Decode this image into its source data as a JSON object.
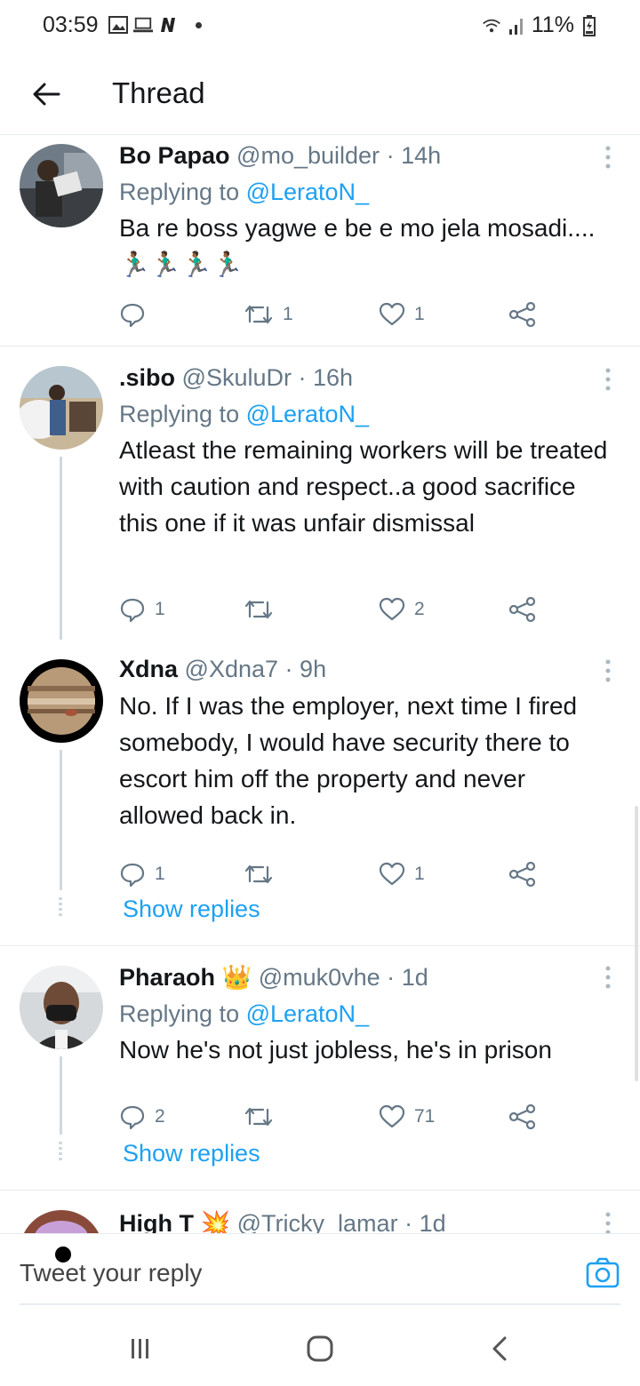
{
  "status_bar": {
    "time": "03:59",
    "battery": "11%"
  },
  "header": {
    "title": "Thread",
    "back_icon": "arrow-left-icon"
  },
  "tweets": [
    {
      "name": "Bo Papao",
      "handle": "@mo_builder",
      "time": "14h",
      "replying_prefix": "Replying to ",
      "replying_to": "@LeratoN_",
      "text": "Ba re boss yagwe e be e mo jela mosadi....🏃🏾‍♂️🏃🏾‍♂️🏃🏾‍♂️🏃🏾‍♂️",
      "reply_count": "",
      "retweet_count": "1",
      "like_count": "1"
    },
    {
      "name": ".sibo",
      "handle": "@SkuluDr",
      "time": "16h",
      "replying_prefix": "Replying to ",
      "replying_to": "@LeratoN_",
      "text": "Atleast the remaining workers will be treated with caution and respect..a good sacrifice this one if it was unfair dismissal",
      "reply_count": "1",
      "retweet_count": "",
      "like_count": "2"
    },
    {
      "name": "Xdna",
      "handle": "@Xdna7",
      "time": "9h",
      "text": "No. If I was the employer, next time I fired somebody, I would have security there to escort him off the property and never allowed back in.",
      "reply_count": "1",
      "retweet_count": "",
      "like_count": "1",
      "show_replies": "Show replies"
    },
    {
      "name": "Pharaoh",
      "name_emoji": "👑",
      "handle": "@muk0vhe",
      "time": "1d",
      "replying_prefix": "Replying to ",
      "replying_to": "@LeratoN_",
      "text": "Now he's not just jobless, he's in prison",
      "reply_count": "2",
      "retweet_count": "",
      "like_count": "71",
      "show_replies": "Show replies"
    },
    {
      "name": "High T",
      "name_emoji": "💥",
      "handle": "@Tricky_lamar",
      "time": "1d"
    }
  ],
  "compose": {
    "placeholder": "Tweet your reply",
    "camera_icon": "camera-icon"
  },
  "navbar": {
    "recents_icon": "recents-icon",
    "home_icon": "home-icon",
    "back_icon": "back-chevron-icon"
  },
  "colors": {
    "accent": "#1da1f2",
    "text": "#14171a",
    "muted": "#657786",
    "divider": "#e6ecf0"
  }
}
